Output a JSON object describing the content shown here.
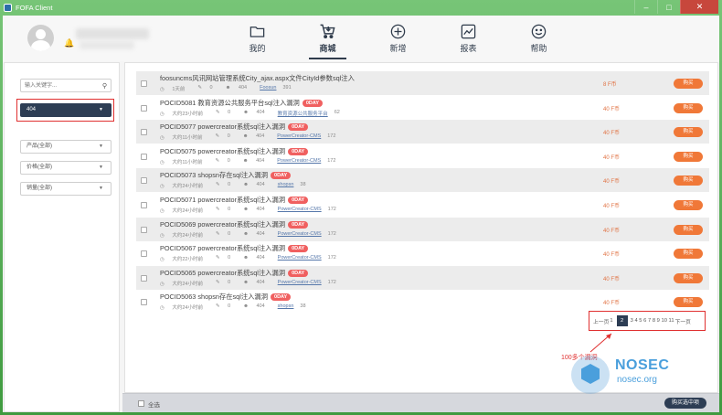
{
  "window": {
    "title": "FOFA Client",
    "controls": [
      "minimize",
      "maximize",
      "close"
    ]
  },
  "nav": [
    {
      "label": "我的",
      "icon": "folder-icon"
    },
    {
      "label": "商城",
      "icon": "cart-icon",
      "active": true
    },
    {
      "label": "新增",
      "icon": "plus-circle-icon"
    },
    {
      "label": "报表",
      "icon": "chart-icon"
    },
    {
      "label": "帮助",
      "icon": "smile-icon"
    }
  ],
  "sidebar": {
    "search_placeholder": "输入关键字...",
    "selected": "404",
    "product": "产品(全部)",
    "price": "价格(全部)",
    "sales": "销量(全部)"
  },
  "items": [
    {
      "name": "foosuncms风讯网站管理系统City_ajax.aspx文件CityId参数sql注入",
      "badge": "",
      "time": "1天前",
      "comments": "0",
      "users": "404",
      "vendor": "Foosun",
      "count": "391",
      "price": "8 F币",
      "buy": "购买"
    },
    {
      "name": "POCID5081 教育资源公共服务平台sql注入漏洞",
      "badge": "0DAY",
      "time": "大约23小时前",
      "comments": "0",
      "users": "404",
      "vendor": "教育资源公共服务平台",
      "count": "62",
      "price": "40 F币",
      "buy": "购买"
    },
    {
      "name": "POCID5077 powercreator系统sql注入漏洞",
      "badge": "0DAY",
      "time": "大约11小时前",
      "comments": "0",
      "users": "404",
      "vendor": "PowerCreator-CMS",
      "count": "172",
      "price": "40 F币",
      "buy": "购买"
    },
    {
      "name": "POCID5075 powercreator系统sql注入漏洞",
      "badge": "0DAY",
      "time": "大约11小时前",
      "comments": "0",
      "users": "404",
      "vendor": "PowerCreator-CMS",
      "count": "172",
      "price": "40 F币",
      "buy": "购买"
    },
    {
      "name": "POCID5073 shopsn存在sql注入漏洞",
      "badge": "0DAY",
      "time": "大约24小时前",
      "comments": "0",
      "users": "404",
      "vendor": "shopsn",
      "count": "38",
      "price": "40 F币",
      "buy": "购买"
    },
    {
      "name": "POCID5071 powercreator系统sql注入漏洞",
      "badge": "0DAY",
      "time": "大约24小时前",
      "comments": "0",
      "users": "404",
      "vendor": "PowerCreator-CMS",
      "count": "172",
      "price": "40 F币",
      "buy": "购买"
    },
    {
      "name": "POCID5069 powercreator系统sql注入漏洞",
      "badge": "0DAY",
      "time": "大约24小时前",
      "comments": "0",
      "users": "404",
      "vendor": "PowerCreator-CMS",
      "count": "172",
      "price": "40 F币",
      "buy": "购买"
    },
    {
      "name": "POCID5067 powercreator系统sql注入漏洞",
      "badge": "0DAY",
      "time": "大约22小时前",
      "comments": "0",
      "users": "404",
      "vendor": "PowerCreator-CMS",
      "count": "172",
      "price": "40 F币",
      "buy": "购买"
    },
    {
      "name": "POCID5065 powercreator系统sql注入漏洞",
      "badge": "0DAY",
      "time": "大约24小时前",
      "comments": "0",
      "users": "404",
      "vendor": "PowerCreator-CMS",
      "count": "172",
      "price": "40 F币",
      "buy": "购买"
    },
    {
      "name": "POCID5063 shopsn存在sql注入漏洞",
      "badge": "0DAY",
      "time": "大约24小时前",
      "comments": "0",
      "users": "404",
      "vendor": "shopsn",
      "count": "38",
      "price": "40 F币",
      "buy": "购买"
    }
  ],
  "pagination": {
    "prev": "上一页",
    "before": "1",
    "current": "2",
    "after": "3 4 5 6 7 8 9 10 11",
    "next": "下一页"
  },
  "annotation": "100多个漏洞",
  "watermark": {
    "title": "NOSEC",
    "subtitle": "nosec.org"
  },
  "bottom": {
    "select_all": "全选",
    "buy_selected": "购买选中项"
  },
  "colors": {
    "accent": "#2d3d54",
    "buy": "#f07838",
    "badge": "#f06060",
    "highlight": "#e03030"
  }
}
